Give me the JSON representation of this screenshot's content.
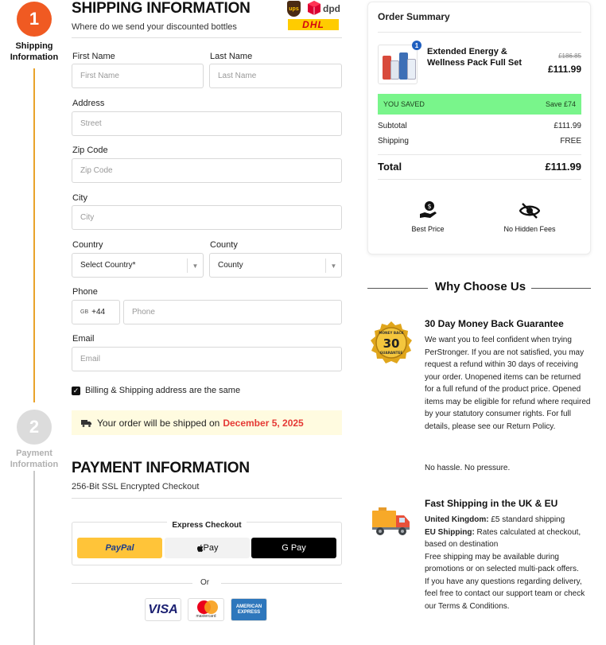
{
  "stepper": {
    "step1_number": "1",
    "step1_label": "Shipping Information",
    "step2_number": "2",
    "step2_label": "Payment Information",
    "active_color": "#f05a22",
    "line_color": "#e9a22a"
  },
  "shipping": {
    "title": "SHIPPING INFORMATION",
    "subtitle": "Where do we send your discounted bottles",
    "carriers": [
      "ups",
      "dpd",
      "DHL"
    ],
    "fields": {
      "first_name_label": "First Name",
      "first_name_placeholder": "First Name",
      "last_name_label": "Last Name",
      "last_name_placeholder": "Last Name",
      "address_label": "Address",
      "address_placeholder": "Street",
      "zip_label": "Zip Code",
      "zip_placeholder": "Zip Code",
      "city_label": "City",
      "city_placeholder": "City",
      "country_label": "Country",
      "country_value": "Select Country*",
      "county_label": "County",
      "county_value": "County",
      "phone_label": "Phone",
      "phone_flag": "GB",
      "phone_code": "+44",
      "phone_placeholder": "Phone",
      "email_label": "Email",
      "email_placeholder": "Email"
    },
    "same_address_label": "Billing & Shipping address are the same",
    "same_address_checked": true,
    "notice_text": "Your order will be shipped on",
    "notice_date": "December 5, 2025"
  },
  "payment": {
    "title": "PAYMENT INFORMATION",
    "subtitle": "256-Bit SSL Encrypted Checkout",
    "express_title": "Express Checkout",
    "paypal_label": "PayPal",
    "applepay_label": " Pay",
    "gpay_label": "G Pay",
    "or_label": "Or",
    "cards": {
      "visa": "VISA",
      "mastercard": "mastercard",
      "amex_line1": "AMERICAN",
      "amex_line2": "EXPRESS"
    }
  },
  "summary": {
    "title": "Order Summary",
    "product_name": "Extended Energy & Wellness Pack Full Set",
    "quantity": "1",
    "price_old": "£186.85",
    "price_new": "£111.99",
    "saved_label": "YOU SAVED",
    "saved_value": "Save £74",
    "subtotal_label": "Subtotal",
    "subtotal_value": "£111.99",
    "shipping_label": "Shipping",
    "shipping_value": "FREE",
    "total_label": "Total",
    "total_value": "£111.99",
    "badge1": "Best Price",
    "badge2": "No Hidden Fees",
    "saved_color": "#79f58b"
  },
  "why": {
    "title": "Why Choose Us",
    "medal_text_top": "MONEY BACK",
    "medal_number": "30",
    "medal_text_bottom": "GUARANTEE",
    "feature1_title": "30 Day Money Back Guarantee",
    "feature1_text": "We want you to feel confident when trying PerStronger. If you are not satisfied, you may request a refund within 30 days of receiving your order. Unopened items can be returned for a full refund of the product price. Opened items may be eligible for refund where required by your statutory consumer rights. For full details, please see our Return Policy.",
    "feature1_extra": "No hassle. No pressure.",
    "feature2_title": "Fast Shipping in the UK & EU",
    "uk_label": "United Kingdom:",
    "uk_text": " £5 standard shipping",
    "eu_label": "EU Shipping:",
    "eu_text": " Rates calculated at checkout, based on destination",
    "free_text": "Free shipping may be available during promotions or on selected multi-pack offers.",
    "contact_text": "If you have any questions regarding delivery, feel free to contact our support team or check our Terms & Conditions."
  }
}
